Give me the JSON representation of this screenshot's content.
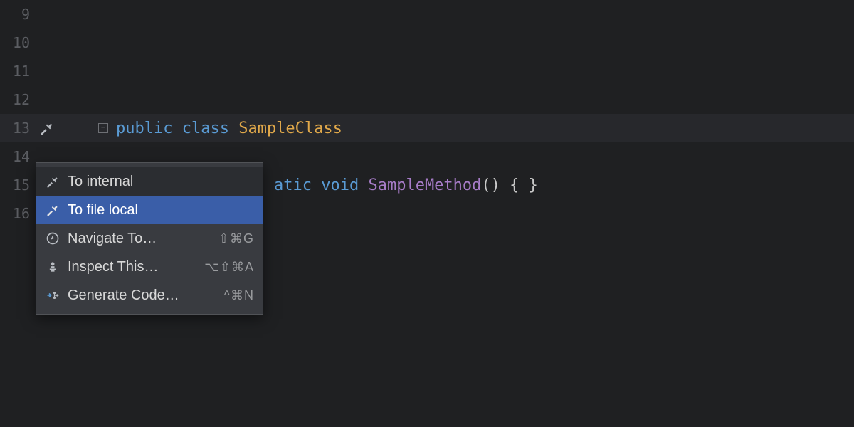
{
  "gutter": {
    "lines": [
      "9",
      "10",
      "11",
      "12",
      "13",
      "14",
      "15",
      "16"
    ],
    "current_line_index": 4
  },
  "code": {
    "line13": {
      "k_public": "public ",
      "k_class": "class ",
      "type_name": "SampleClass"
    },
    "line15": {
      "indent": "    ",
      "fragment_atic": "atic ",
      "k_void": "void ",
      "method_name": "SampleMethod",
      "tail": "() { }"
    }
  },
  "menu": {
    "items": [
      {
        "label": "To internal",
        "shortcut": "",
        "icon": "hammer-icon",
        "state": "hovered"
      },
      {
        "label": "To file local",
        "shortcut": "",
        "icon": "hammer-icon",
        "state": "selected"
      },
      {
        "label": "Navigate To…",
        "shortcut": "⇧⌘G",
        "icon": "compass-icon",
        "state": ""
      },
      {
        "label": "Inspect This…",
        "shortcut": "⌥⇧⌘A",
        "icon": "inspector-icon",
        "state": ""
      },
      {
        "label": "Generate Code…",
        "shortcut": "^⌘N",
        "icon": "generate-icon",
        "state": ""
      }
    ]
  }
}
